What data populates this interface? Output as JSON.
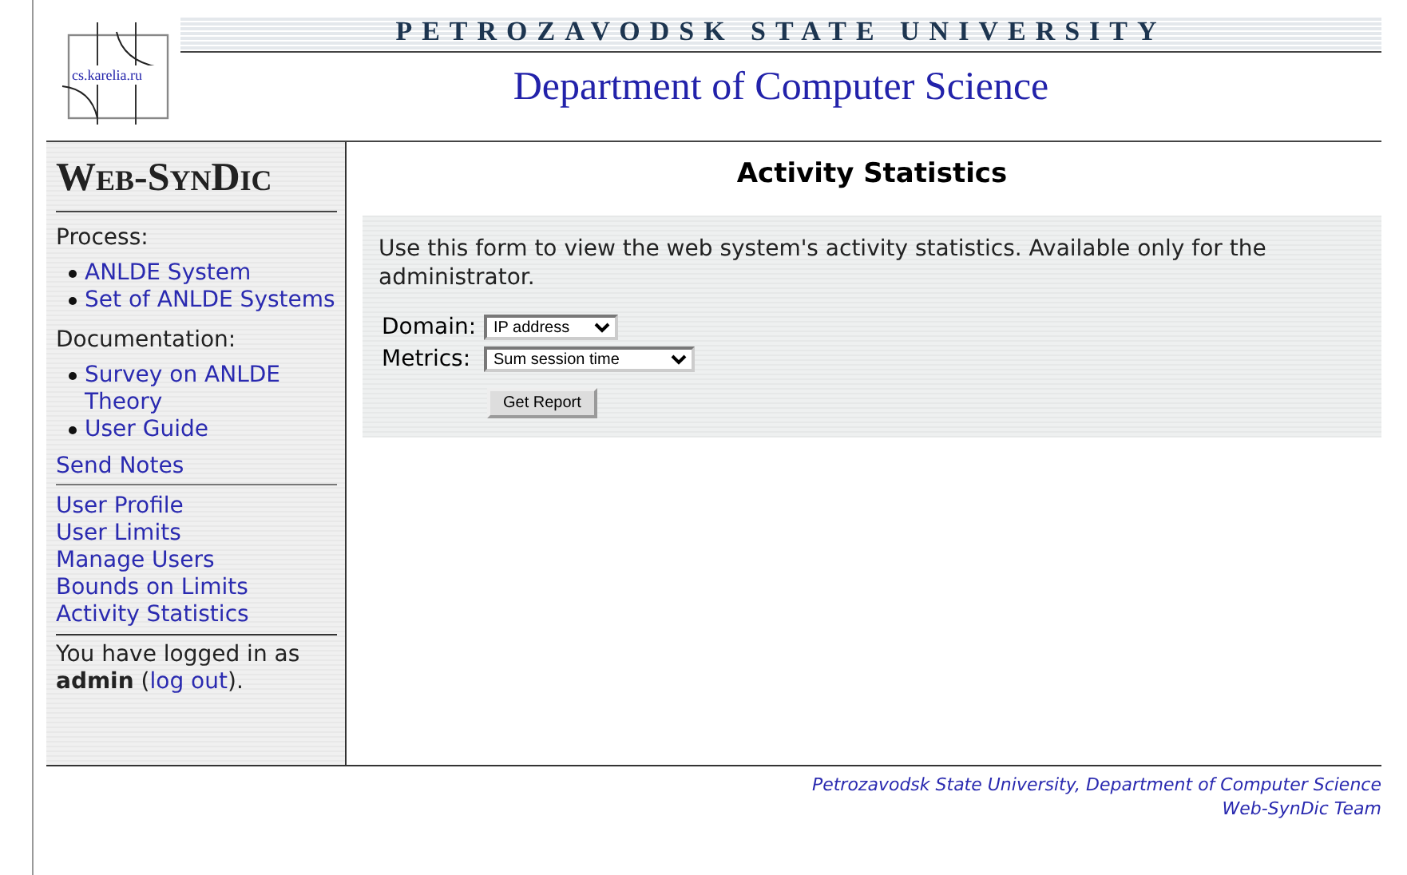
{
  "header": {
    "logo_text": "cs.karelia.ru",
    "university": "PETROZAVODSK STATE UNIVERSITY",
    "department": "Department of Computer Science"
  },
  "sidebar": {
    "title": "Web-SynDic",
    "nav": [
      {
        "kind": "heading",
        "text": "Process:"
      },
      {
        "kind": "bullet",
        "text": "ANLDE System"
      },
      {
        "kind": "bullet",
        "text": "Set of ANLDE Systems"
      },
      {
        "kind": "heading",
        "text": "Documentation:"
      },
      {
        "kind": "bullet",
        "text": "Survey on ANLDE Theory"
      },
      {
        "kind": "bullet",
        "text": "User Guide"
      },
      {
        "kind": "link",
        "text": "Send Notes"
      }
    ],
    "admin_links": [
      "User Profile",
      "User Limits",
      "Manage Users",
      "Bounds on Limits",
      "Activity Statistics"
    ],
    "login": {
      "before": "You have logged in as ",
      "user": "admin",
      "middle": " (",
      "link": "log out",
      "after": ")."
    }
  },
  "main": {
    "title": "Activity Statistics",
    "intro": "Use this form to view the web system's activity statistics. Available only for the administrator.",
    "fields": [
      {
        "label": "Domain:",
        "value": "IP address",
        "kind": "short"
      },
      {
        "label": "Metrics:",
        "value": "Sum session time",
        "kind": "long"
      }
    ],
    "button": "Get Report"
  },
  "footer": {
    "line1": "Petrozavodsk State University, Department of Computer Science",
    "line2": "Web-SynDic Team"
  }
}
